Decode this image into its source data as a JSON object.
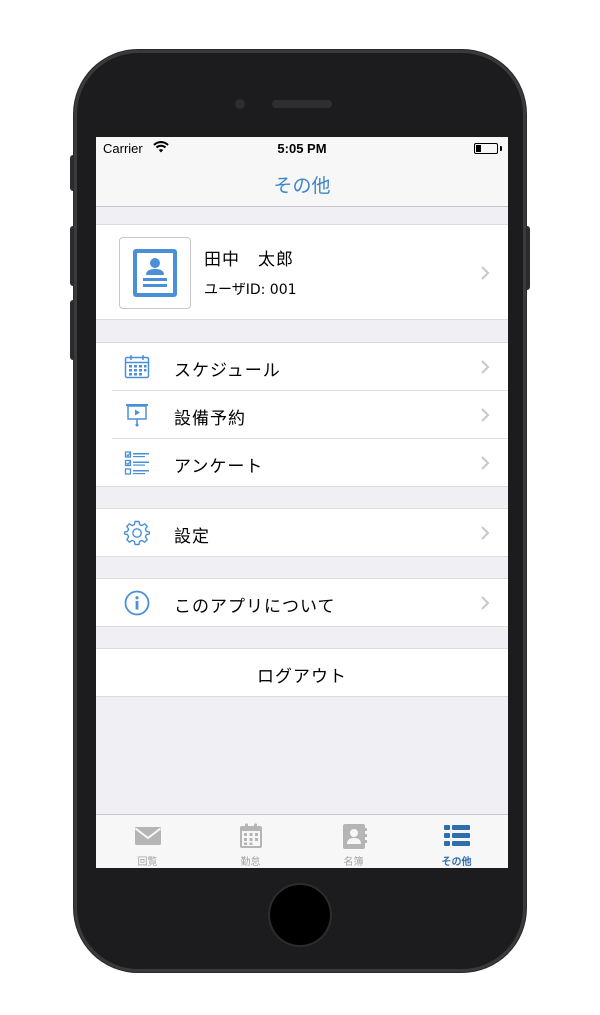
{
  "status_bar": {
    "carrier": "Carrier",
    "time": "5:05 PM"
  },
  "nav": {
    "title": "その他"
  },
  "profile": {
    "name": "田中　太郎",
    "user_id": "ユーザID: 001"
  },
  "menu": {
    "schedule": "スケジュール",
    "facility": "設備予約",
    "survey": "アンケート",
    "settings": "設定",
    "about": "このアプリについて",
    "logout": "ログアウト"
  },
  "tabs": [
    {
      "label": "回覧",
      "icon": "mail-icon",
      "active": false
    },
    {
      "label": "勤怠",
      "icon": "calendar-icon",
      "active": false
    },
    {
      "label": "名簿",
      "icon": "contacts-icon",
      "active": false
    },
    {
      "label": "その他",
      "icon": "list-icon",
      "active": true
    }
  ],
  "colors": {
    "accent": "#3c86c7",
    "icon_blue": "#4a90d9",
    "tab_active": "#2e6eb0",
    "tab_inactive": "#a3a3a3"
  }
}
